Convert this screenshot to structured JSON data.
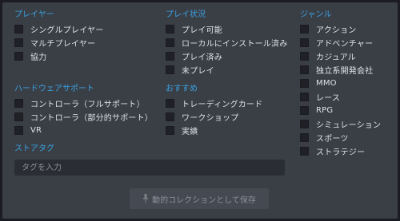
{
  "colors": {
    "accent": "#3aa3e3",
    "panel": "#3a3e45",
    "checkbox": "#1f2126"
  },
  "players": {
    "title": "プレイヤー",
    "items": [
      "シングルプレイヤー",
      "マルチプレイヤー",
      "協力"
    ]
  },
  "hardware": {
    "title": "ハードウェアサポート",
    "items": [
      "コントローラ（フルサポート）",
      "コントローラ（部分的サポート）",
      "VR"
    ]
  },
  "store_tags": {
    "title": "ストアタグ",
    "placeholder": "タグを入力"
  },
  "play_status": {
    "title": "プレイ状況",
    "items": [
      "プレイ可能",
      "ローカルにインストール済み",
      "プレイ済み",
      "未プレイ"
    ]
  },
  "recommended": {
    "title": "おすすめ",
    "items": [
      "トレーディングカード",
      "ワークショップ",
      "実績"
    ]
  },
  "genre": {
    "title": "ジャンル",
    "items": [
      "アクション",
      "アドベンチャー",
      "カジュアル",
      "独立系開発会社",
      "MMO",
      "レース",
      "RPG",
      "シミュレーション",
      "スポーツ",
      "ストラテジー"
    ]
  },
  "save_button": {
    "label": "動的コレクションとして保存",
    "icon": "pin-icon"
  }
}
